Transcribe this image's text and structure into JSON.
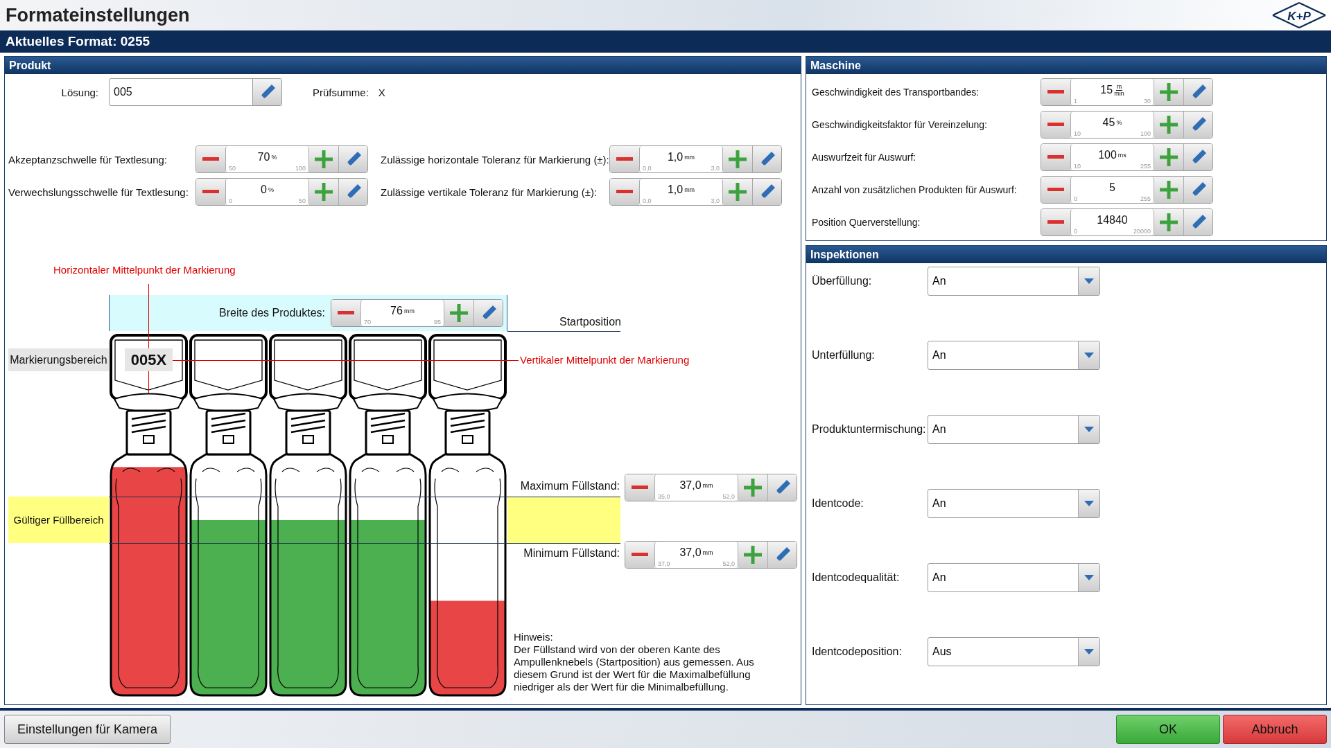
{
  "window": {
    "title": "Formateinstellungen",
    "logo": "K+P"
  },
  "format_bar": {
    "text": "Aktuelles Format: 0255"
  },
  "product": {
    "title": "Produkt",
    "solution": {
      "label": "Lösung:",
      "value": "005"
    },
    "checksum": {
      "label": "Prüfsumme:",
      "value": "X"
    },
    "spinners": [
      {
        "label": "Akzeptanzschwelle für Textlesung:",
        "value": "70",
        "unit": "%",
        "min": "50",
        "max": "100"
      },
      {
        "label": "Zulässige horizontale Toleranz für Markierung (±):",
        "value": "1,0",
        "unit": "mm",
        "min": "0,0",
        "max": "3,0"
      },
      {
        "label": "Verwechslungsschwelle für Textlesung:",
        "value": "0",
        "unit": "%",
        "min": "0",
        "max": "50"
      },
      {
        "label": "Zulässige vertikale Toleranz für Markierung (±):",
        "value": "1,0",
        "unit": "mm",
        "min": "0,0",
        "max": "3,0"
      }
    ],
    "diagram": {
      "horizontal_center_label": "Horizontaler Mittelpunkt der Markierung",
      "width": {
        "label": "Breite des Produktes:",
        "value": "76",
        "unit": "mm",
        "min": "70",
        "max": "95"
      },
      "start_label": "Startposition",
      "marking_area_label": "Markierungsbereich",
      "marking_text": "005X",
      "vertical_center_label": "Vertikaler Mittelpunkt der Markierung",
      "valid_fill_label": "Gültiger Füllbereich",
      "max_fill": {
        "label": "Maximum Füllstand:",
        "value": "37,0",
        "unit": "mm",
        "min": "35,0",
        "max": "52,0"
      },
      "min_fill": {
        "label": "Minimum Füllstand:",
        "value": "37,0",
        "unit": "mm",
        "min": "37,0",
        "max": "52,0"
      },
      "note_title": "Hinweis:",
      "note": "Der Füllstand wird von der oberen Kante des Ampullenknebels (Startposition) aus gemessen. Aus diesem Grund ist der Wert für die Maximalbefüllung niedriger als der Wert für die Minimalbefüllung.",
      "bottles": [
        {
          "level": 0.99,
          "color": "#e84646"
        },
        {
          "level": 0.76,
          "color": "#4cb050"
        },
        {
          "level": 0.76,
          "color": "#4cb050"
        },
        {
          "level": 0.76,
          "color": "#4cb050"
        },
        {
          "level": 0.41,
          "color": "#e84646"
        }
      ]
    }
  },
  "machine": {
    "title": "Maschine",
    "spinners": [
      {
        "label": "Geschwindigkeit des Transportbandes:",
        "value": "15",
        "unit": {
          "numerator": "m",
          "denominator": "min"
        },
        "min": "1",
        "max": "30"
      },
      {
        "label": "Geschwindigkeitsfaktor für Vereinzelung:",
        "value": "45",
        "unit": "%",
        "min": "10",
        "max": "100"
      },
      {
        "label": "Auswurfzeit für Auswurf:",
        "value": "100",
        "unit": "ms",
        "min": "10",
        "max": "255"
      },
      {
        "label": "Anzahl von zusätzlichen Produkten für Auswurf:",
        "value": "5",
        "min": "0",
        "max": "255"
      },
      {
        "label": "Position Querverstellung:",
        "value": "14840",
        "min": "0",
        "max": "20000"
      }
    ]
  },
  "inspections": {
    "title": "Inspektionen",
    "items": [
      {
        "label": "Überfüllung:",
        "value": "An"
      },
      {
        "label": "Unterfüllung:",
        "value": "An"
      },
      {
        "label": "Produktuntermischung:",
        "value": "An"
      },
      {
        "label": "Identcode:",
        "value": "An"
      },
      {
        "label": "Identcodequalität:",
        "value": "An"
      },
      {
        "label": "Identcodeposition:",
        "value": "Aus"
      }
    ]
  },
  "buttons": [
    {
      "label": "Einstellungen für Kamera",
      "kind": "default"
    },
    {
      "label": "OK",
      "kind": "ok"
    },
    {
      "label": "Abbruch",
      "kind": "cancel"
    }
  ]
}
